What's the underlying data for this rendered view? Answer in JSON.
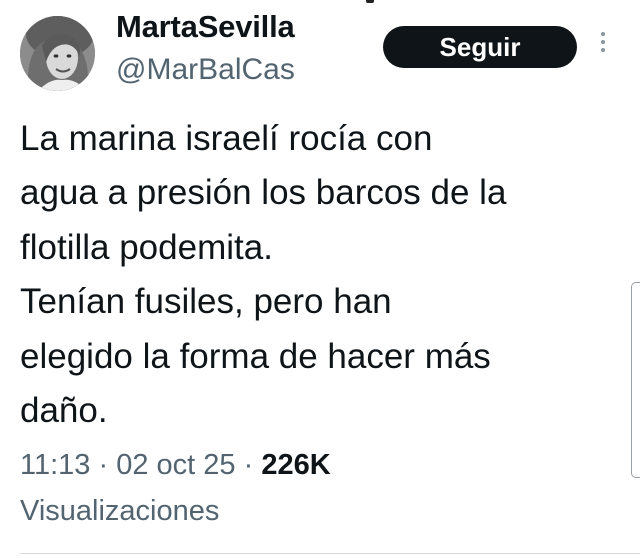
{
  "tweet": {
    "author": {
      "display_name": "MartaSevilla",
      "handle": "@MarBalCas",
      "avatar_icon": "profile-photo"
    },
    "follow_label": "Seguir",
    "more_icon": "vertical-ellipsis-icon",
    "text_lines": [
      "La marina israelí rocía con",
      "agua a presión los barcos de la",
      "flotilla podemita.",
      "Tenían fusiles, pero han",
      "elegido la forma de hacer más",
      "daño."
    ],
    "meta": {
      "time": "11:13",
      "separator": " · ",
      "date": "02 oct 25",
      "views_count": "226K",
      "views_label": "Visualizaciones"
    }
  },
  "colors": {
    "follow_button_bg": "#0f1419",
    "follow_button_text": "#ffffff",
    "primary_text": "#0f1419",
    "secondary_text": "#536471"
  }
}
